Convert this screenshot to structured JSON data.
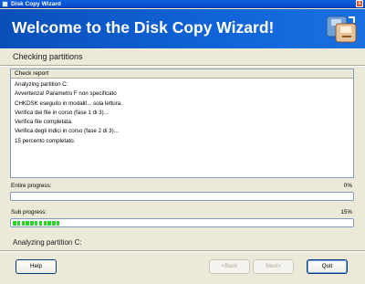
{
  "window": {
    "title": "Disk Copy Wizard",
    "close_glyph": "x"
  },
  "banner": {
    "heading": "Welcome to the Disk Copy Wizard!",
    "logo_icon": "disk-copy-logo-icon"
  },
  "step": {
    "title": "Checking partitions"
  },
  "report": {
    "header": "Check report",
    "lines": [
      "Analyzing partition C:",
      "Avvertenza! Parametro F non specificato",
      "CHKDSK eseguito in modalit... sola lettura.",
      "Verifica dei file in corso (fase 1 di 3)...",
      "Verifica file completata.",
      "Verifica degli indici in corso (fase 2 di 3)...",
      "15 percento completato."
    ]
  },
  "progress": {
    "entire": {
      "label": "Entire progress:",
      "percent_text": "0%",
      "value": 0
    },
    "sub": {
      "label": "Sub progress:",
      "percent_text": "15%",
      "value": 15
    }
  },
  "status": {
    "text": "Analyzing partition C:"
  },
  "buttons": {
    "help": "Help",
    "back": "<Back",
    "next": "Next>",
    "quit": "Quit"
  },
  "colors": {
    "banner": "#1064D8",
    "progress_fill": "#2CD12C",
    "titlebar": "#0A5FE0"
  }
}
